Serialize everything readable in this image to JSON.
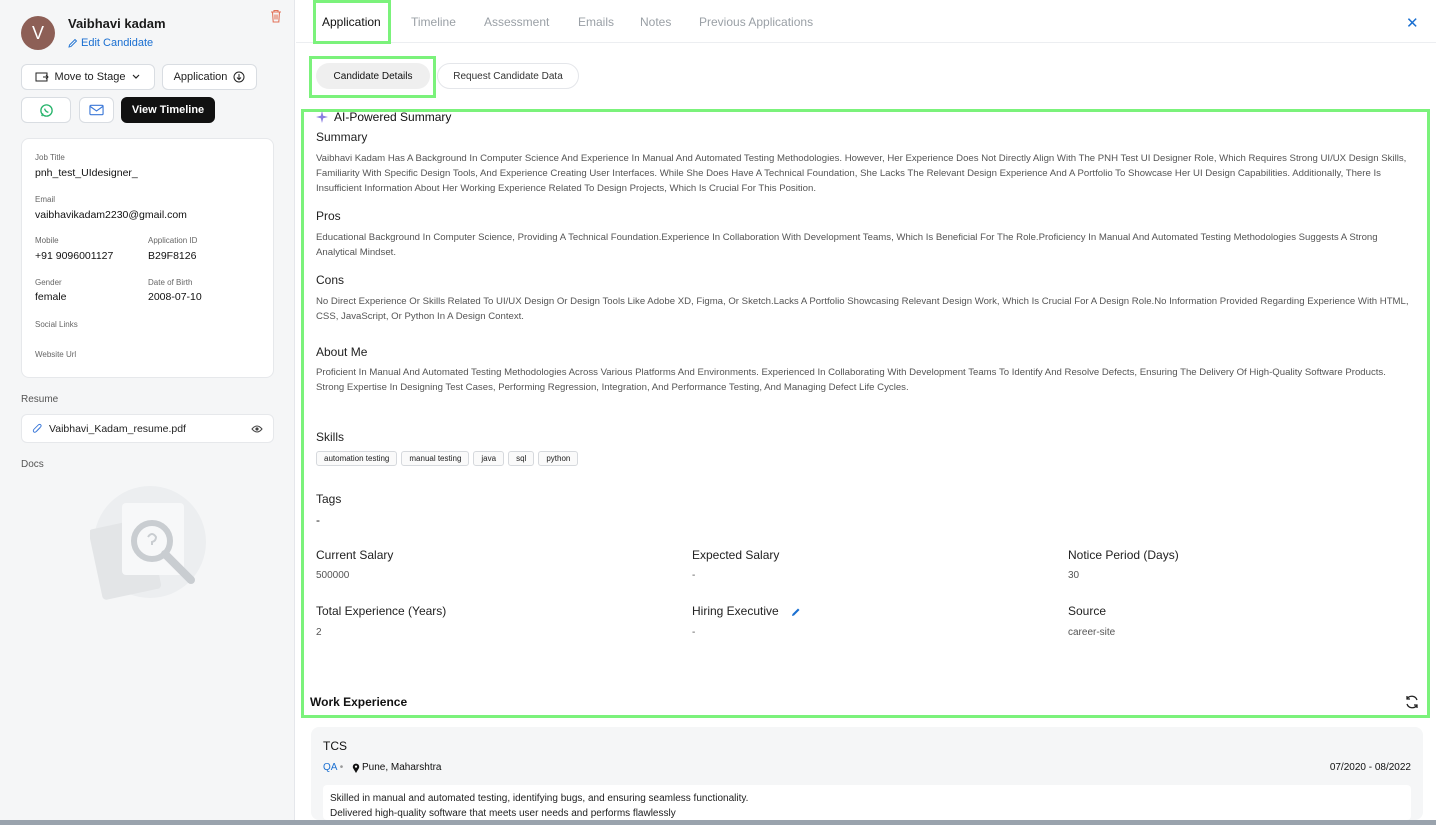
{
  "candidate": {
    "avatar_letter": "V",
    "name": "Vaibhavi kadam",
    "edit_label": "Edit Candidate"
  },
  "actions": {
    "move_to_stage": "Move to Stage",
    "application": "Application",
    "view_timeline": "View Timeline"
  },
  "details": {
    "job_title_label": "Job Title",
    "job_title": "pnh_test_UIdesigner_",
    "email_label": "Email",
    "email": "vaibhavikadam2230@gmail.com",
    "mobile_label": "Mobile",
    "mobile": "+91 9096001127",
    "application_id_label": "Application ID",
    "application_id": "B29F8126",
    "gender_label": "Gender",
    "gender": "female",
    "dob_label": "Date of Birth",
    "dob": "2008-07-10",
    "social_links_label": "Social Links",
    "website_label": "Website Url"
  },
  "resume": {
    "title": "Resume",
    "file": "Vaibhavi_Kadam_resume.pdf"
  },
  "docs": {
    "title": "Docs"
  },
  "tabs": [
    "Application",
    "Timeline",
    "Assessment",
    "Emails",
    "Notes",
    "Previous Applications"
  ],
  "subtabs": [
    "Candidate Details",
    "Request Candidate Data"
  ],
  "ai": {
    "title": "AI-Powered Summary",
    "summary_label": "Summary",
    "summary": "Vaibhavi Kadam Has A Background In Computer Science And Experience In Manual And Automated Testing Methodologies. However, Her Experience Does Not Directly Align With The PNH Test UI Designer Role, Which Requires Strong UI/UX Design Skills, Familiarity With Specific Design Tools, And Experience Creating User Interfaces. While She Does Have A Technical Foundation, She Lacks The Relevant Design Experience And A Portfolio To Showcase Her UI Design Capabilities. Additionally, There Is Insufficient Information About Her Working Experience Related To Design Projects, Which Is Crucial For This Position.",
    "pros_label": "Pros",
    "pros": "Educational Background In Computer Science, Providing A Technical Foundation.Experience In Collaboration With Development Teams, Which Is Beneficial For The Role.Proficiency In Manual And Automated Testing Methodologies Suggests A Strong Analytical Mindset.",
    "cons_label": "Cons",
    "cons": "No Direct Experience Or Skills Related To UI/UX Design Or Design Tools Like Adobe XD, Figma, Or Sketch.Lacks A Portfolio Showcasing Relevant Design Work, Which Is Crucial For A Design Role.No Information Provided Regarding Experience With HTML, CSS, JavaScript, Or Python In A Design Context."
  },
  "about": {
    "label": "About Me",
    "text": "Proficient In Manual And Automated Testing Methodologies Across Various Platforms And Environments. Experienced In Collaborating With Development Teams To Identify And Resolve Defects, Ensuring The Delivery Of High-Quality Software Products. Strong Expertise In Designing Test Cases, Performing Regression, Integration, And Performance Testing, And Managing Defect Life Cycles."
  },
  "skills": {
    "label": "Skills",
    "items": [
      "automation testing",
      "manual testing",
      "java",
      "sql",
      "python"
    ]
  },
  "tags": {
    "label": "Tags",
    "value": "-"
  },
  "fields": {
    "current_salary_label": "Current Salary",
    "current_salary": "500000",
    "expected_salary_label": "Expected Salary",
    "expected_salary": "-",
    "notice_label": "Notice Period (Days)",
    "notice": "30",
    "experience_label": "Total Experience (Years)",
    "experience": "2",
    "hiring_exec_label": "Hiring Executive",
    "hiring_exec": "-",
    "source_label": "Source",
    "source": "career-site"
  },
  "work": {
    "title": "Work Experience",
    "company": "TCS",
    "role": "QA",
    "location": "Pune, Maharshtra",
    "dates": "07/2020 - 08/2022",
    "desc_line1": "Skilled in manual and automated testing, identifying bugs, and ensuring seamless functionality.",
    "desc_line2": "Delivered high-quality software that meets user needs and performs flawlessly"
  },
  "colors": {
    "accent": "#1a6fd1",
    "highlight": "#7bf27b",
    "avatar": "#8d5f56"
  }
}
